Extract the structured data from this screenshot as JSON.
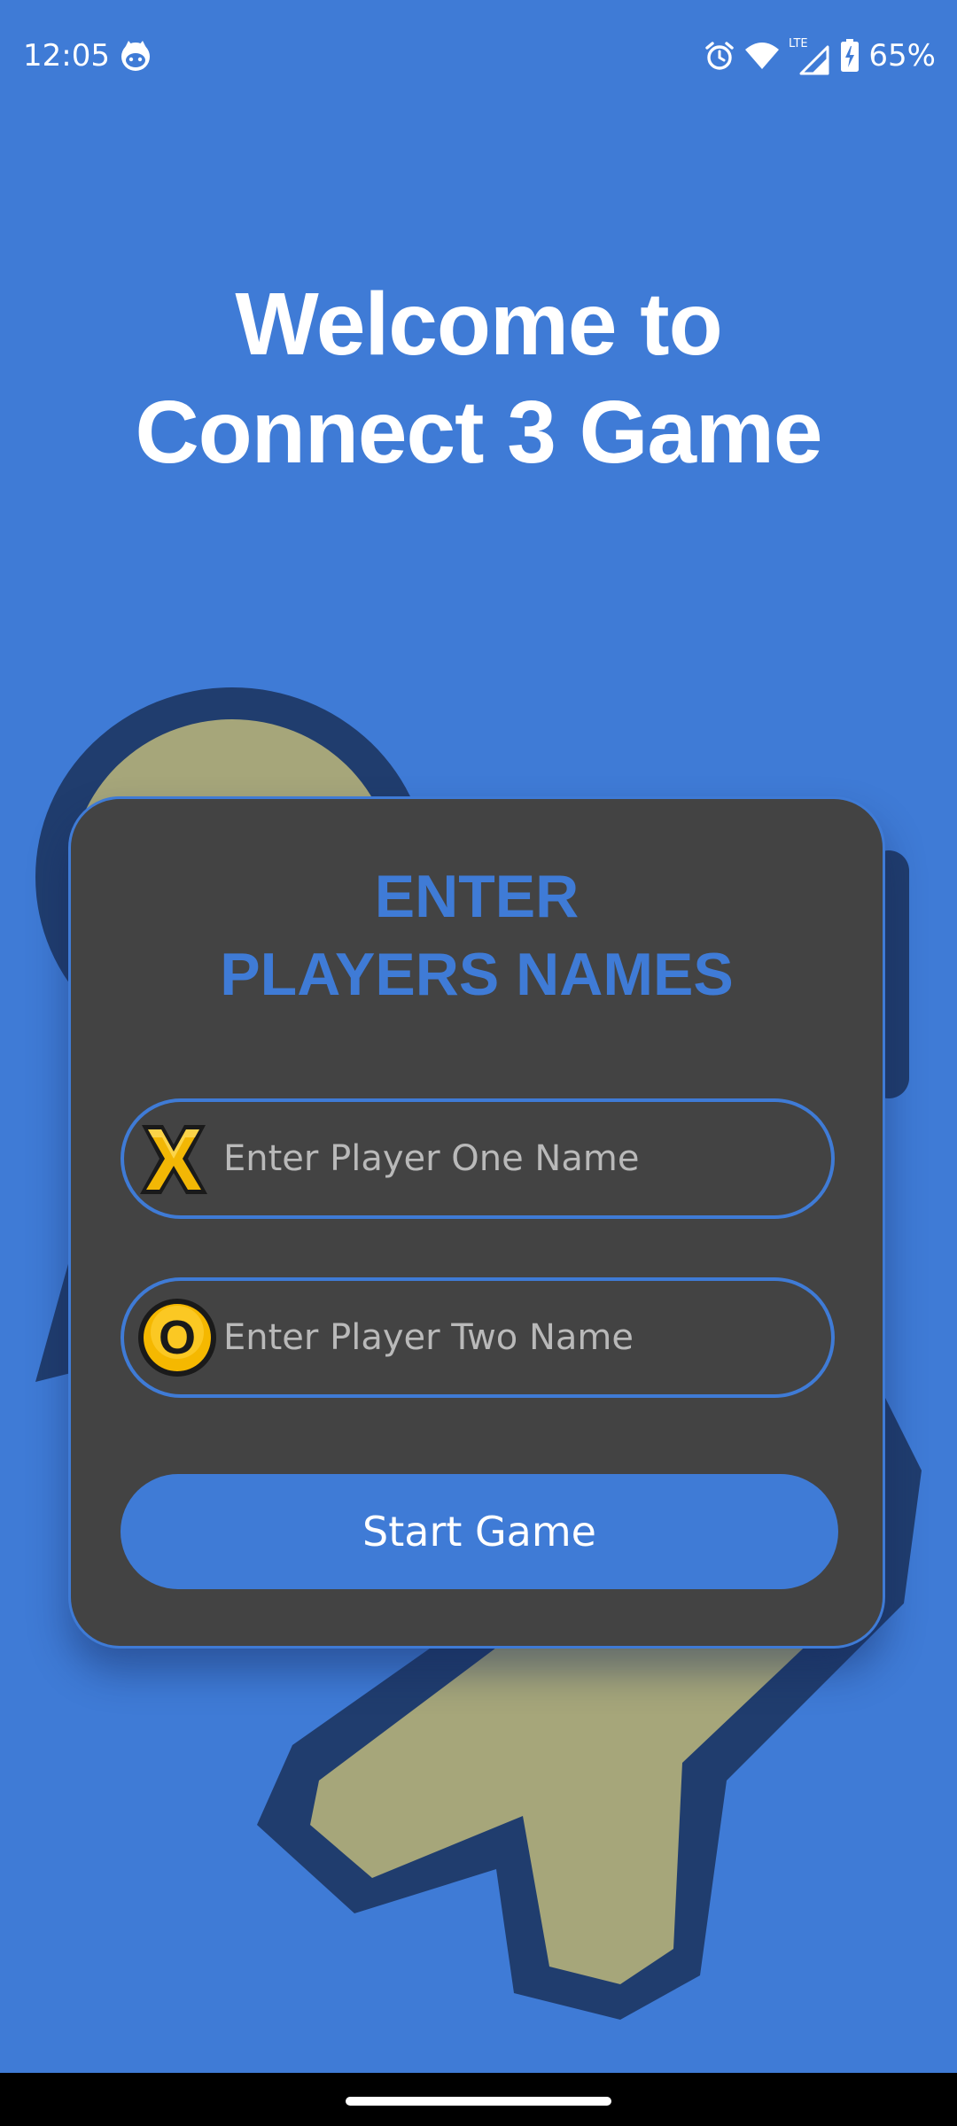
{
  "status_bar": {
    "time": "12:05",
    "app_icon": "cat-face-icon",
    "icons": [
      "alarm-icon",
      "wifi-icon",
      "lte-signal-icon",
      "battery-charging-icon"
    ],
    "network_label": "LTE",
    "battery_percent": "65%"
  },
  "welcome": {
    "line1": "Welcome to",
    "line2": "Connect 3 Game"
  },
  "form": {
    "title_line1": "ENTER",
    "title_line2": "PLAYERS NAMES",
    "player_one": {
      "icon": "x-mark-icon",
      "placeholder": "Enter Player One Name",
      "value": ""
    },
    "player_two": {
      "icon": "o-mark-icon",
      "placeholder": "Enter Player Two Name",
      "value": ""
    },
    "start_label": "Start Game"
  },
  "colors": {
    "background": "#3f7bd6",
    "card": "#434343",
    "accent": "#3f7bd6",
    "decor_fill": "#a6a67a",
    "decor_outline": "#203d6e",
    "x_icon": "#f2b705",
    "o_icon": "#f5b800"
  }
}
